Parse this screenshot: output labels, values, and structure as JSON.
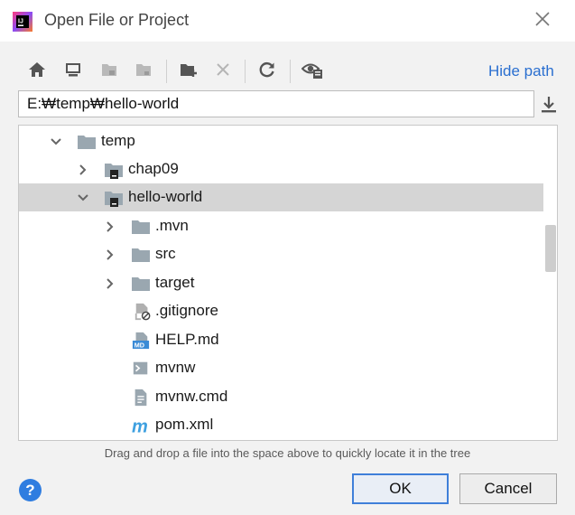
{
  "window": {
    "title": "Open File or Project"
  },
  "toolbar": {
    "hide_path_label": "Hide path"
  },
  "path": {
    "value": "E:₩temp₩hello-world"
  },
  "tree": {
    "items": [
      {
        "label": "temp",
        "icon": "folder-icon"
      },
      {
        "label": "chap09",
        "icon": "module-folder-icon"
      },
      {
        "label": "hello-world",
        "icon": "module-folder-icon"
      },
      {
        "label": ".mvn",
        "icon": "folder-icon"
      },
      {
        "label": "src",
        "icon": "folder-icon"
      },
      {
        "label": "target",
        "icon": "folder-icon"
      },
      {
        "label": ".gitignore",
        "icon": "ignored-file-icon"
      },
      {
        "label": "HELP.md",
        "icon": "markdown-file-icon"
      },
      {
        "label": "mvnw",
        "icon": "shell-script-icon"
      },
      {
        "label": "mvnw.cmd",
        "icon": "text-file-icon"
      },
      {
        "label": "pom.xml",
        "icon": "maven-icon"
      }
    ]
  },
  "hint": "Drag and drop a file into the space above to quickly locate it in the tree",
  "buttons": {
    "help": "?",
    "ok": "OK",
    "cancel": "Cancel"
  },
  "colors": {
    "accent": "#2a6fd0",
    "selection": "#d5d5d5",
    "folder": "#9aa7b0"
  }
}
